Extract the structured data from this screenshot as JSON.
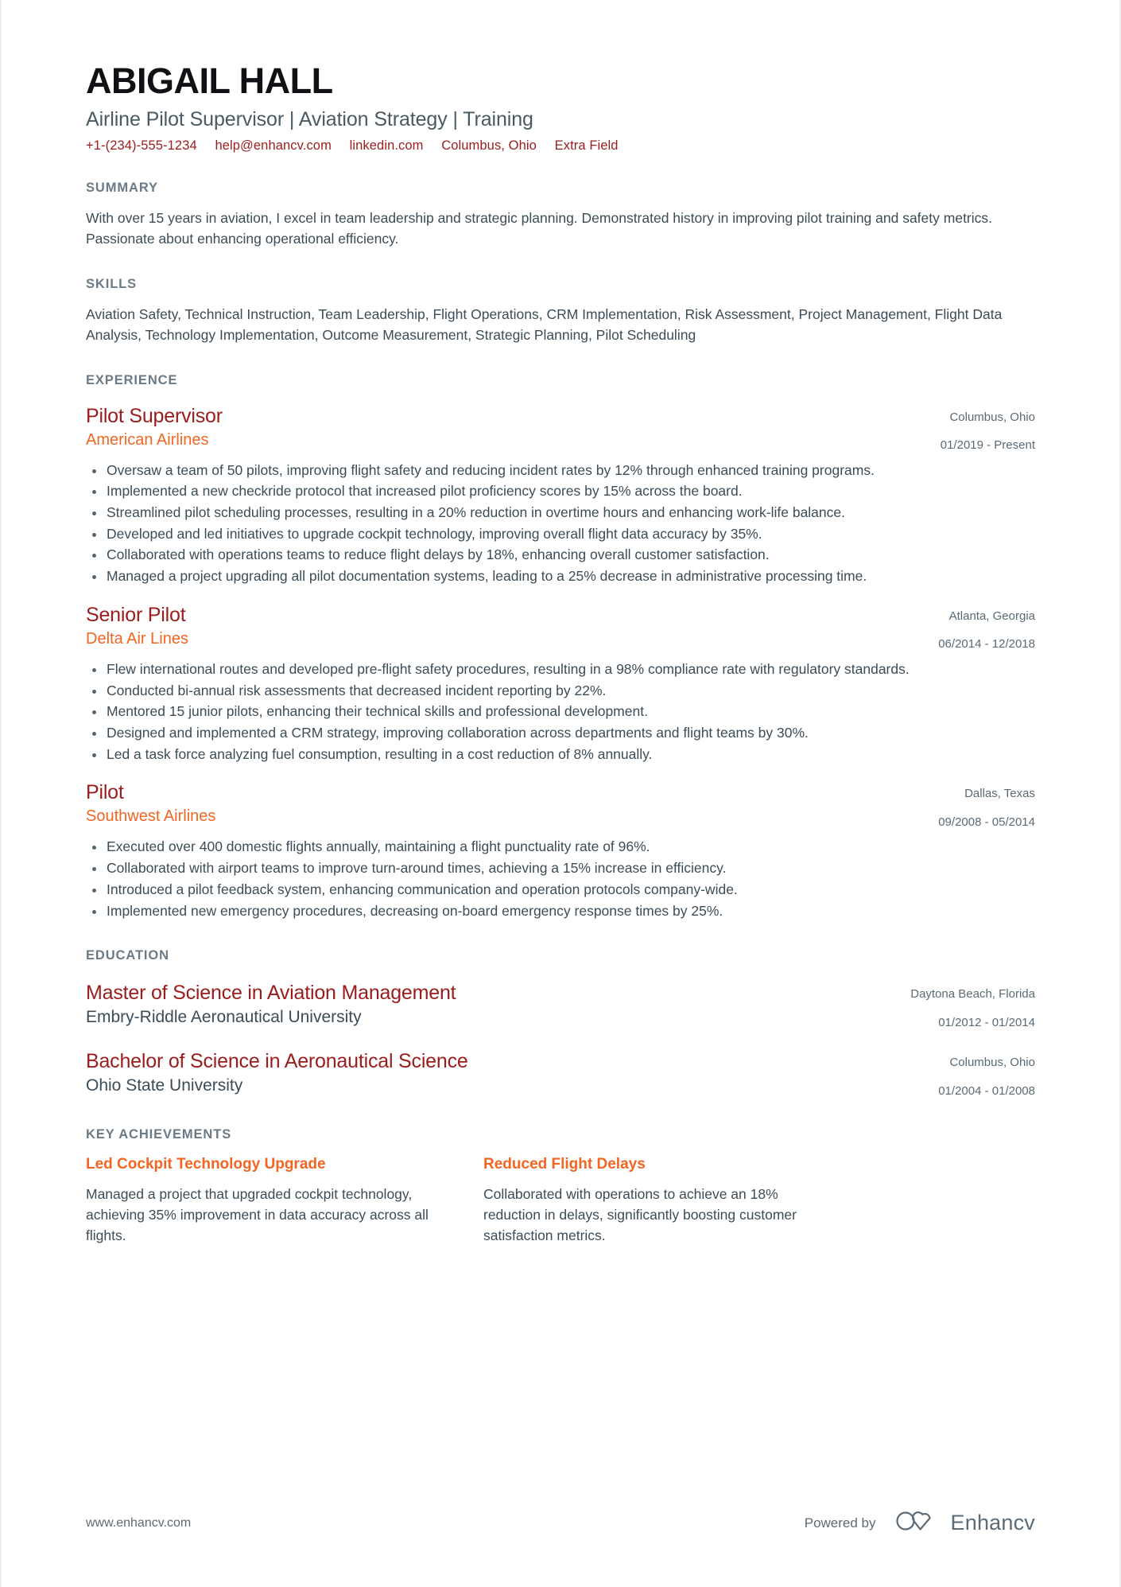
{
  "header": {
    "full_name": "ABIGAIL HALL",
    "headline": "Airline Pilot Supervisor | Aviation Strategy | Training",
    "contacts": [
      {
        "name": "phone",
        "text": "+1-(234)-555-1234"
      },
      {
        "name": "email",
        "text": "help@enhancv.com"
      },
      {
        "name": "linkedin",
        "text": "linkedin.com"
      },
      {
        "name": "location",
        "text": "Columbus, Ohio"
      },
      {
        "name": "extra",
        "text": "Extra Field"
      }
    ]
  },
  "summary": {
    "title": "SUMMARY",
    "text": "With over 15 years in aviation, I excel in team leadership and strategic planning. Demonstrated history in improving pilot training and safety metrics. Passionate about enhancing operational efficiency."
  },
  "skills": {
    "title": "SKILLS",
    "text": "Aviation Safety, Technical Instruction, Team Leadership, Flight Operations, CRM Implementation, Risk Assessment, Project Management, Flight Data Analysis, Technology Implementation, Outcome Measurement, Strategic Planning, Pilot Scheduling"
  },
  "experience": {
    "title": "EXPERIENCE",
    "entries": [
      {
        "role": "Pilot Supervisor",
        "company": "American Airlines",
        "location": "Columbus, Ohio",
        "dates": "01/2019 - Present",
        "bullets": [
          "Oversaw a team of 50 pilots, improving flight safety and reducing incident rates by 12% through enhanced training programs.",
          "Implemented a new checkride protocol that increased pilot proficiency scores by 15% across the board.",
          "Streamlined pilot scheduling processes, resulting in a 20% reduction in overtime hours and enhancing work-life balance.",
          "Developed and led initiatives to upgrade cockpit technology, improving overall flight data accuracy by 35%.",
          "Collaborated with operations teams to reduce flight delays by 18%, enhancing overall customer satisfaction.",
          "Managed a project upgrading all pilot documentation systems, leading to a 25% decrease in administrative processing time."
        ]
      },
      {
        "role": "Senior Pilot",
        "company": "Delta Air Lines",
        "location": "Atlanta, Georgia",
        "dates": "06/2014 - 12/2018",
        "bullets": [
          "Flew international routes and developed pre-flight safety procedures, resulting in a 98% compliance rate with regulatory standards.",
          "Conducted bi-annual risk assessments that decreased incident reporting by 22%.",
          "Mentored 15 junior pilots, enhancing their technical skills and professional development.",
          "Designed and implemented a CRM strategy, improving collaboration across departments and flight teams by 30%.",
          "Led a task force analyzing fuel consumption, resulting in a cost reduction of 8% annually."
        ]
      },
      {
        "role": "Pilot",
        "company": "Southwest Airlines",
        "location": "Dallas, Texas",
        "dates": "09/2008 - 05/2014",
        "bullets": [
          "Executed over 400 domestic flights annually, maintaining a flight punctuality rate of 96%.",
          "Collaborated with airport teams to improve turn-around times, achieving a 15% increase in efficiency.",
          "Introduced a pilot feedback system, enhancing communication and operation protocols company-wide.",
          "Implemented new emergency procedures, decreasing on-board emergency response times by 25%."
        ]
      }
    ]
  },
  "education": {
    "title": "EDUCATION",
    "entries": [
      {
        "degree": "Master of Science in Aviation Management",
        "school": "Embry-Riddle Aeronautical University",
        "location": "Daytona Beach, Florida",
        "dates": "01/2012 - 01/2014"
      },
      {
        "degree": "Bachelor of Science in Aeronautical Science",
        "school": "Ohio State University",
        "location": "Columbus, Ohio",
        "dates": "01/2004 - 01/2008"
      }
    ]
  },
  "key_achievements": {
    "title": "KEY ACHIEVEMENTS",
    "items": [
      {
        "title": "Led Cockpit Technology Upgrade",
        "text": "Managed a project that upgraded cockpit technology, achieving 35% improvement in data accuracy across all flights."
      },
      {
        "title": "Reduced Flight Delays",
        "text": "Collaborated with operations to achieve an 18% reduction in delays, significantly boosting customer satisfaction metrics."
      }
    ]
  },
  "footer": {
    "url": "www.enhancv.com",
    "powered_by": "Powered by",
    "brand": "Enhancv"
  },
  "colors": {
    "name": "#0f1114",
    "headline": "#4a5a63",
    "contact": "#9b1c1c",
    "section_title": "#6b7a85",
    "entry_title": "#9b1c1c",
    "company": "#f26522",
    "body": "#3c4c56",
    "meta": "#5a6a74"
  }
}
